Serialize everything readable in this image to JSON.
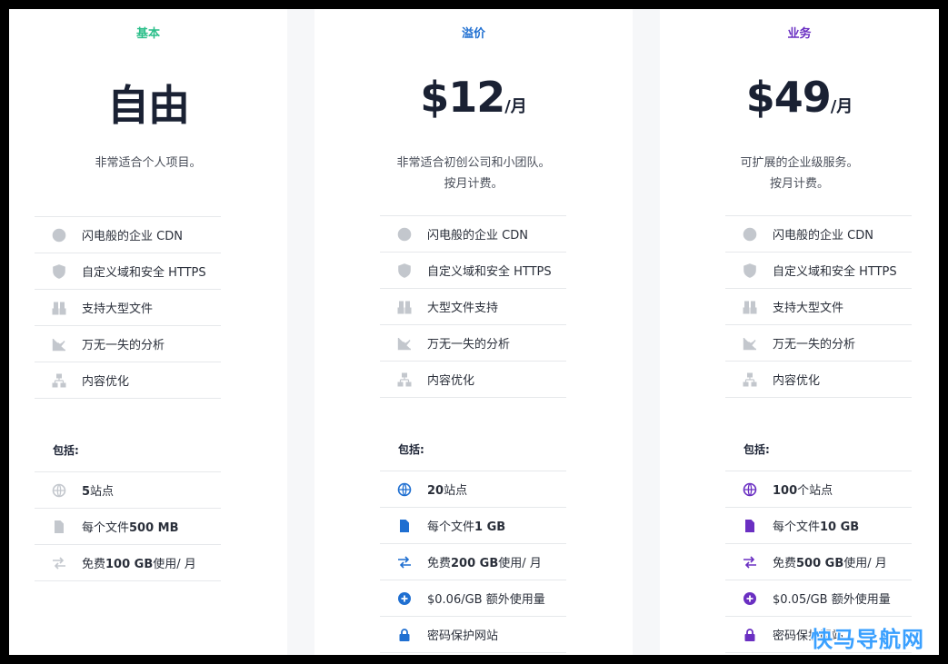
{
  "plans": [
    {
      "tier": "基本",
      "tier_color": "#2bbf8a",
      "price_big": "自由",
      "price_unit": "",
      "desc_line1": "非常适合个人项目。",
      "desc_line2": "",
      "features": [
        "闪电般的企业 CDN",
        "自定义域和安全 HTTPS",
        "支持大型文件",
        "万无一失的分析",
        "内容优化"
      ],
      "includes_title": "包括:",
      "includes": [
        {
          "bold": "5",
          "text": "站点",
          "icon": "globe-icon"
        },
        {
          "pre": "每个文件",
          "bold": "500 MB",
          "icon": "file-icon"
        },
        {
          "pre": "免费",
          "bold": "100 GB",
          "text": "使用/ 月",
          "icon": "transfer-icon"
        }
      ],
      "accent": "#c3c7cd"
    },
    {
      "tier": "溢价",
      "tier_color": "#1f6fd1",
      "price_big": "$12",
      "price_unit": "/月",
      "desc_line1": "非常适合初创公司和小团队。",
      "desc_line2": "按月计费。",
      "features": [
        "闪电般的企业 CDN",
        "自定义域和安全 HTTPS",
        "大型文件支持",
        "万无一失的分析",
        "内容优化"
      ],
      "includes_title": "包括:",
      "includes": [
        {
          "bold": "20",
          "text": "站点",
          "icon": "globe-icon"
        },
        {
          "pre": "每个文件",
          "bold": "1 GB",
          "icon": "file-icon"
        },
        {
          "pre": "免费",
          "bold": "200 GB",
          "text": "使用/ 月",
          "icon": "transfer-icon"
        },
        {
          "text": "$0.06/GB 额外使用量",
          "icon": "plus-circle-icon"
        },
        {
          "text": "密码保护网站",
          "icon": "lock-icon"
        }
      ],
      "accent": "#1f6fd1"
    },
    {
      "tier": "业务",
      "tier_color": "#6a2fc2",
      "price_big": "$49",
      "price_unit": "/月",
      "desc_line1": "可扩展的企业级服务。",
      "desc_line2": "按月计费。",
      "features": [
        "闪电般的企业 CDN",
        "自定义域和安全 HTTPS",
        "支持大型文件",
        "万无一失的分析",
        "内容优化"
      ],
      "includes_title": "包括:",
      "includes": [
        {
          "bold": "100",
          "text": "个站点",
          "icon": "globe-icon"
        },
        {
          "pre": "每个文件",
          "bold": "10 GB",
          "icon": "file-icon"
        },
        {
          "pre": "免费",
          "bold": "500 GB",
          "text": "使用/ 月",
          "icon": "transfer-icon"
        },
        {
          "text": "$0.05/GB 额外使用量",
          "icon": "plus-circle-icon"
        },
        {
          "text": "密码保护网站",
          "icon": "lock-icon"
        }
      ],
      "accent": "#6a2fc2"
    }
  ],
  "feature_icons": [
    "globe-icon",
    "shield-icon",
    "boxes-icon",
    "chart-icon",
    "sitemap-icon"
  ],
  "watermark": "快马导航网"
}
